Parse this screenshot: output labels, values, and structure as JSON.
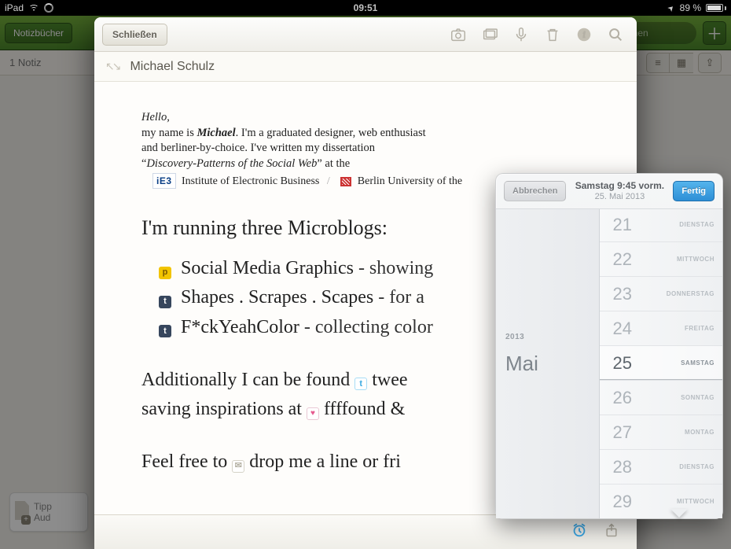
{
  "statusbar": {
    "device": "iPad",
    "time": "09:51",
    "battery": "89 %"
  },
  "greenbar": {
    "back_label": "Notizbücher",
    "search_placeholder": "suchen"
  },
  "subbar": {
    "count_label": "1 Notiz"
  },
  "tip": {
    "line1": "Tipp",
    "line2": "Aud"
  },
  "note": {
    "close_label": "Schließen",
    "title": "Michael Schulz",
    "intro": {
      "hello": "Hello,",
      "line2a": "my name is ",
      "name": "Michael",
      "line2b": ". I'm a graduated designer, web enthusiast",
      "line3": "and berliner-by-choice. I've written my dissertation",
      "line4a": "“",
      "quote": "Discovery-Patterns of the Social Web",
      "line4b": "” at the",
      "inst1": "Institute of Electronic Business",
      "inst2": "Berlin University of the"
    },
    "heading": "I'm running three Microblogs:",
    "blogs": [
      {
        "icon": "p",
        "name": "Social Media Graphics",
        "suffix": "  - showing"
      },
      {
        "icon": "t",
        "name": "Shapes . Scrapes . Scapes",
        "suffix": "  - for a"
      },
      {
        "icon": "t",
        "name": "F*ckYeahColor",
        "suffix": "  - collecting color"
      }
    ],
    "para2": {
      "a": "Additionally I can be found  ",
      "tw": "twee",
      "b": "saving inspirations at  ",
      "ff": "ffffound",
      "amp": "  &"
    },
    "para3": {
      "a": "Feel free to  ",
      "mail": "drop me a line",
      "b": "  or fri"
    }
  },
  "datepicker": {
    "cancel": "Abbrechen",
    "done": "Fertig",
    "title_line1": "Samstag 9:45 vorm.",
    "title_line2": "25. Mai 2013",
    "year": "2013",
    "month": "Mai",
    "days": [
      {
        "n": "21",
        "wd": "DIENSTAG"
      },
      {
        "n": "22",
        "wd": "MITTWOCH"
      },
      {
        "n": "23",
        "wd": "DONNERSTAG"
      },
      {
        "n": "24",
        "wd": "FREITAG"
      },
      {
        "n": "25",
        "wd": "SAMSTAG",
        "selected": true
      },
      {
        "n": "26",
        "wd": "SONNTAG"
      },
      {
        "n": "27",
        "wd": "MONTAG"
      },
      {
        "n": "28",
        "wd": "DIENSTAG"
      },
      {
        "n": "29",
        "wd": "MITTWOCH"
      }
    ]
  }
}
